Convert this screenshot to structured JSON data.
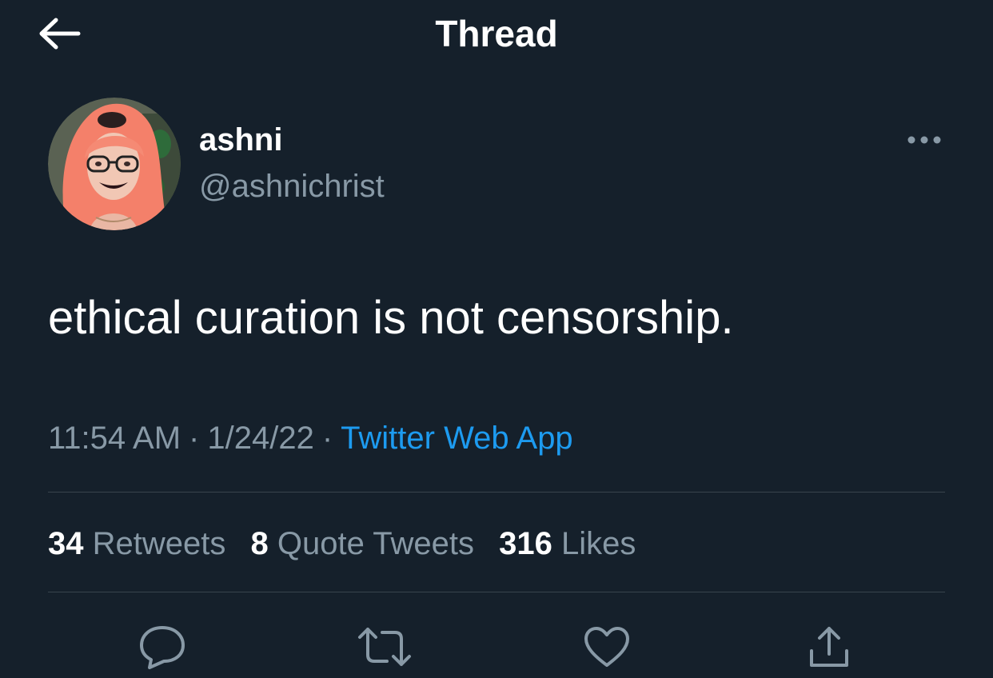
{
  "header": {
    "title": "Thread",
    "back_icon": "arrow-left-icon"
  },
  "tweet": {
    "author": {
      "display_name": "ashni",
      "handle": "@ashnichrist"
    },
    "text": "ethical curation is not censorship.",
    "meta": {
      "time": "11:54 AM",
      "separator": "·",
      "date": "1/24/22",
      "source": "Twitter Web App"
    },
    "stats": {
      "retweets": {
        "count": "34",
        "label": "Retweets"
      },
      "quotes": {
        "count": "8",
        "label": "Quote Tweets"
      },
      "likes": {
        "count": "316",
        "label": "Likes"
      }
    },
    "actions": [
      "reply-icon",
      "retweet-icon",
      "like-icon",
      "share-icon"
    ]
  },
  "colors": {
    "background": "#15202b",
    "text_primary": "#ffffff",
    "text_secondary": "#8899a6",
    "accent": "#1d9bf0",
    "divider": "#38444d"
  }
}
